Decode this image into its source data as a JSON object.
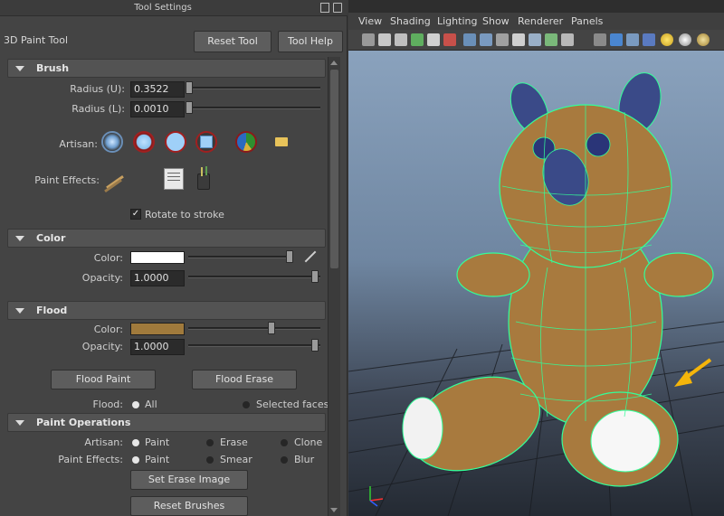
{
  "panel": {
    "title": "Tool Settings",
    "tool_name": "3D Paint Tool",
    "reset_tool": "Reset Tool",
    "tool_help": "Tool Help"
  },
  "brush": {
    "header": "Brush",
    "radius_u_label": "Radius (U):",
    "radius_u_value": "0.3522",
    "radius_l_label": "Radius (L):",
    "radius_l_value": "0.0010",
    "artisan_label": "Artisan:",
    "paint_effects_label": "Paint Effects:",
    "rotate_to_stroke": "Rotate to stroke",
    "rotate_checked": true
  },
  "color": {
    "header": "Color",
    "color_label": "Color:",
    "color_swatch": "#ffffff",
    "opacity_label": "Opacity:",
    "opacity_value": "1.0000"
  },
  "flood": {
    "header": "Flood",
    "color_label": "Color:",
    "color_swatch": "#a07a3c",
    "opacity_label": "Opacity:",
    "opacity_value": "1.0000",
    "flood_paint": "Flood Paint",
    "flood_erase": "Flood Erase",
    "flood_label": "Flood:",
    "opt_all": "All",
    "opt_selected": "Selected faces"
  },
  "paint_ops": {
    "header": "Paint Operations",
    "artisan_label": "Artisan:",
    "artisan_paint": "Paint",
    "artisan_erase": "Erase",
    "artisan_clone": "Clone",
    "pe_label": "Paint Effects:",
    "pe_paint": "Paint",
    "pe_smear": "Smear",
    "pe_blur": "Blur",
    "set_erase_image": "Set Erase Image",
    "reset_brushes": "Reset Brushes"
  },
  "viewport": {
    "menus": [
      "View",
      "Shading",
      "Lighting",
      "Show",
      "Renderer",
      "Panels"
    ],
    "model_color": "#a87a3e",
    "wire_color": "#33ff99",
    "arrow_color": "#f5b50a"
  }
}
